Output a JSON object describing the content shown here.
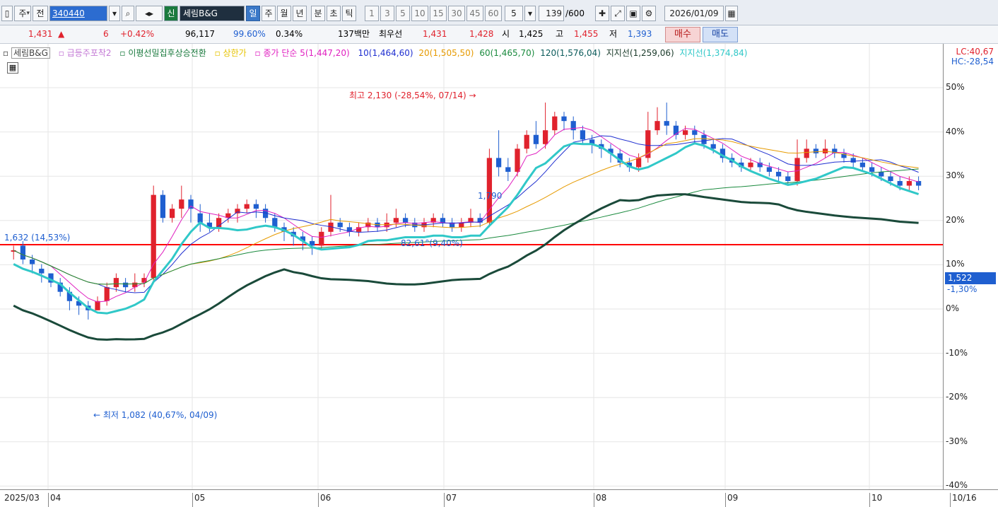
{
  "toolbar": {
    "type_btn": "주",
    "prev_btn": "전",
    "code": "340440",
    "new_btn": "신",
    "stock_name": "세림B&G",
    "periods": [
      "일",
      "주",
      "월",
      "년",
      "분",
      "초",
      "틱"
    ],
    "period_nums": [
      "1",
      "3",
      "5",
      "10",
      "15",
      "30",
      "45",
      "60"
    ],
    "n_value": "5",
    "count": "139",
    "count_total": "/600",
    "date": "2026/01/09"
  },
  "quote": {
    "price": "1,431",
    "arrow": "▲",
    "change": "6",
    "change_pct": "+0.42%",
    "volume": "96,117",
    "vol_pct": "99.60%",
    "turnover": "0.34%",
    "amount": "137백만",
    "best_label": "최우선",
    "ask": "1,431",
    "bid": "1,428",
    "open_label": "시",
    "open": "1,425",
    "high_label": "고",
    "high": "1,455",
    "low_label": "저",
    "low": "1,393",
    "buy": "매수",
    "sell": "매도"
  },
  "legend": {
    "name": "세림B&G",
    "ind1": "급등주포착2",
    "ind2": "이평선밀집후상승전환",
    "ind3": "상한가",
    "ma_label": "종가 단순 5(1,447,20)",
    "ma10": "10(1,464,60)",
    "ma20": "20(1,505,50)",
    "ma60": "60(1,465,70)",
    "ma120": "120(1,576,04)",
    "support1": "지지선(1,259,06)",
    "support2": "지지선(1,374,84)",
    "lc": "LC:40,67",
    "hc": "HC:-28,54"
  },
  "annotations": {
    "high": "최고 2,130 (-28,54%, 07/14)",
    "low": "최저 1,082 (40,67%, 04/09)",
    "hline": "1,632 (14,53%)",
    "mid": "82,61°(9,40%)",
    "point": "1,790"
  },
  "price_box": "1,522",
  "price_pct": "-1,30%",
  "colors": {
    "up": "#e0222d",
    "down": "#1f5fd0",
    "hline": "#ff0000"
  },
  "chart_data": {
    "type": "line",
    "y_ticks": [
      "50%",
      "40%",
      "30%",
      "20%",
      "10%",
      "0%",
      "-10%",
      "-20%",
      "-30%",
      "-40%"
    ],
    "x_ticks": [
      "2025/03",
      "04",
      "05",
      "06",
      "07",
      "08",
      "09",
      "10",
      "10/16"
    ],
    "candles": [
      [
        1,
        38,
        38,
        36,
        39
      ],
      [
        2,
        39,
        36,
        35,
        40
      ],
      [
        3,
        36,
        35,
        33,
        37
      ],
      [
        4,
        34,
        33,
        31,
        35
      ],
      [
        5,
        33,
        31,
        30,
        33
      ],
      [
        6,
        31,
        29,
        28,
        32
      ],
      [
        7,
        29,
        27,
        25,
        30
      ],
      [
        8,
        27,
        26,
        24,
        28
      ],
      [
        9,
        26,
        25,
        23,
        27
      ],
      [
        10,
        25,
        27,
        25,
        28
      ],
      [
        11,
        27,
        30,
        26,
        31
      ],
      [
        12,
        30,
        32,
        29,
        33
      ],
      [
        13,
        31,
        30,
        29,
        32
      ],
      [
        14,
        30,
        31,
        29,
        33
      ],
      [
        15,
        31,
        32,
        30,
        33
      ],
      [
        16,
        32,
        50,
        31,
        52
      ],
      [
        17,
        50,
        45,
        44,
        51
      ],
      [
        18,
        45,
        47,
        44,
        48
      ],
      [
        19,
        47,
        49,
        45,
        52
      ],
      [
        20,
        49,
        47,
        44,
        50
      ],
      [
        21,
        46,
        44,
        42,
        48
      ],
      [
        22,
        44,
        43,
        42,
        46
      ],
      [
        23,
        43,
        45,
        42,
        46
      ],
      [
        24,
        45,
        46,
        44,
        47
      ],
      [
        25,
        46,
        47,
        44,
        48
      ],
      [
        26,
        47,
        48,
        46,
        49
      ],
      [
        27,
        48,
        47,
        45,
        49
      ],
      [
        28,
        47,
        45,
        44,
        48
      ],
      [
        29,
        45,
        43,
        42,
        46
      ],
      [
        30,
        43,
        42,
        40,
        44
      ],
      [
        31,
        42,
        41,
        39,
        43
      ],
      [
        32,
        41,
        40,
        38,
        42
      ],
      [
        33,
        40,
        39,
        37,
        41
      ],
      [
        34,
        39,
        42,
        38,
        43
      ],
      [
        35,
        42,
        44,
        41,
        50
      ],
      [
        36,
        44,
        43,
        42,
        45
      ],
      [
        37,
        43,
        42,
        41,
        44
      ],
      [
        38,
        42,
        43,
        41,
        44
      ],
      [
        39,
        43,
        44,
        42,
        45
      ],
      [
        40,
        44,
        43,
        42,
        45
      ],
      [
        41,
        43,
        44,
        42,
        46
      ],
      [
        42,
        44,
        45,
        43,
        47
      ],
      [
        43,
        45,
        44,
        43,
        46
      ],
      [
        44,
        44,
        43,
        42,
        45
      ],
      [
        45,
        43,
        44,
        42,
        45
      ],
      [
        46,
        44,
        45,
        43,
        46
      ],
      [
        47,
        45,
        44,
        43,
        46
      ],
      [
        48,
        44,
        43,
        42,
        45
      ],
      [
        49,
        43,
        44,
        42,
        45
      ],
      [
        50,
        44,
        45,
        43,
        47
      ],
      [
        51,
        45,
        44,
        43,
        46
      ],
      [
        52,
        44,
        58,
        43,
        60
      ],
      [
        53,
        58,
        56,
        54,
        64
      ],
      [
        54,
        56,
        55,
        53,
        58
      ],
      [
        55,
        55,
        60,
        54,
        61
      ],
      [
        56,
        60,
        63,
        59,
        64
      ],
      [
        57,
        63,
        61,
        60,
        66
      ],
      [
        58,
        61,
        64,
        60,
        70
      ],
      [
        59,
        64,
        67,
        63,
        68
      ],
      [
        60,
        67,
        66,
        64,
        68
      ],
      [
        61,
        66,
        64,
        62,
        67
      ],
      [
        62,
        64,
        62,
        61,
        65
      ],
      [
        63,
        62,
        61,
        59,
        63
      ],
      [
        64,
        61,
        60,
        58,
        62
      ],
      [
        65,
        60,
        59,
        57,
        61
      ],
      [
        66,
        59,
        57,
        56,
        60
      ],
      [
        67,
        57,
        56,
        55,
        58
      ],
      [
        68,
        56,
        58,
        55,
        59
      ],
      [
        69,
        58,
        64,
        57,
        68
      ],
      [
        70,
        64,
        66,
        63,
        69
      ],
      [
        71,
        66,
        65,
        63,
        70
      ],
      [
        72,
        65,
        63,
        62,
        66
      ],
      [
        73,
        63,
        64,
        62,
        65
      ],
      [
        74,
        64,
        63,
        61,
        65
      ],
      [
        75,
        63,
        61,
        60,
        64
      ],
      [
        76,
        61,
        60,
        59,
        62
      ],
      [
        77,
        60,
        58,
        57,
        61
      ],
      [
        78,
        58,
        57,
        56,
        59
      ],
      [
        79,
        57,
        56,
        55,
        58
      ],
      [
        80,
        56,
        57,
        55,
        58
      ],
      [
        81,
        57,
        56,
        55,
        58
      ],
      [
        82,
        56,
        55,
        54,
        57
      ],
      [
        83,
        55,
        54,
        53,
        56
      ],
      [
        84,
        54,
        53,
        52,
        55
      ],
      [
        85,
        53,
        58,
        52,
        62
      ],
      [
        86,
        58,
        60,
        57,
        62
      ],
      [
        87,
        60,
        59,
        58,
        61
      ],
      [
        88,
        59,
        60,
        58,
        62
      ],
      [
        89,
        60,
        59,
        58,
        61
      ],
      [
        90,
        59,
        58,
        57,
        60
      ],
      [
        91,
        58,
        57,
        56,
        59
      ],
      [
        92,
        57,
        56,
        55,
        58
      ],
      [
        93,
        56,
        55,
        54,
        57
      ],
      [
        94,
        55,
        54,
        53,
        56
      ],
      [
        95,
        54,
        53,
        52,
        55
      ],
      [
        96,
        53,
        52,
        51,
        54
      ],
      [
        97,
        52,
        53,
        51,
        54
      ],
      [
        98,
        53,
        52,
        51,
        54
      ]
    ],
    "xlim": [
      0,
      100
    ],
    "ylim": [
      0,
      72
    ]
  }
}
